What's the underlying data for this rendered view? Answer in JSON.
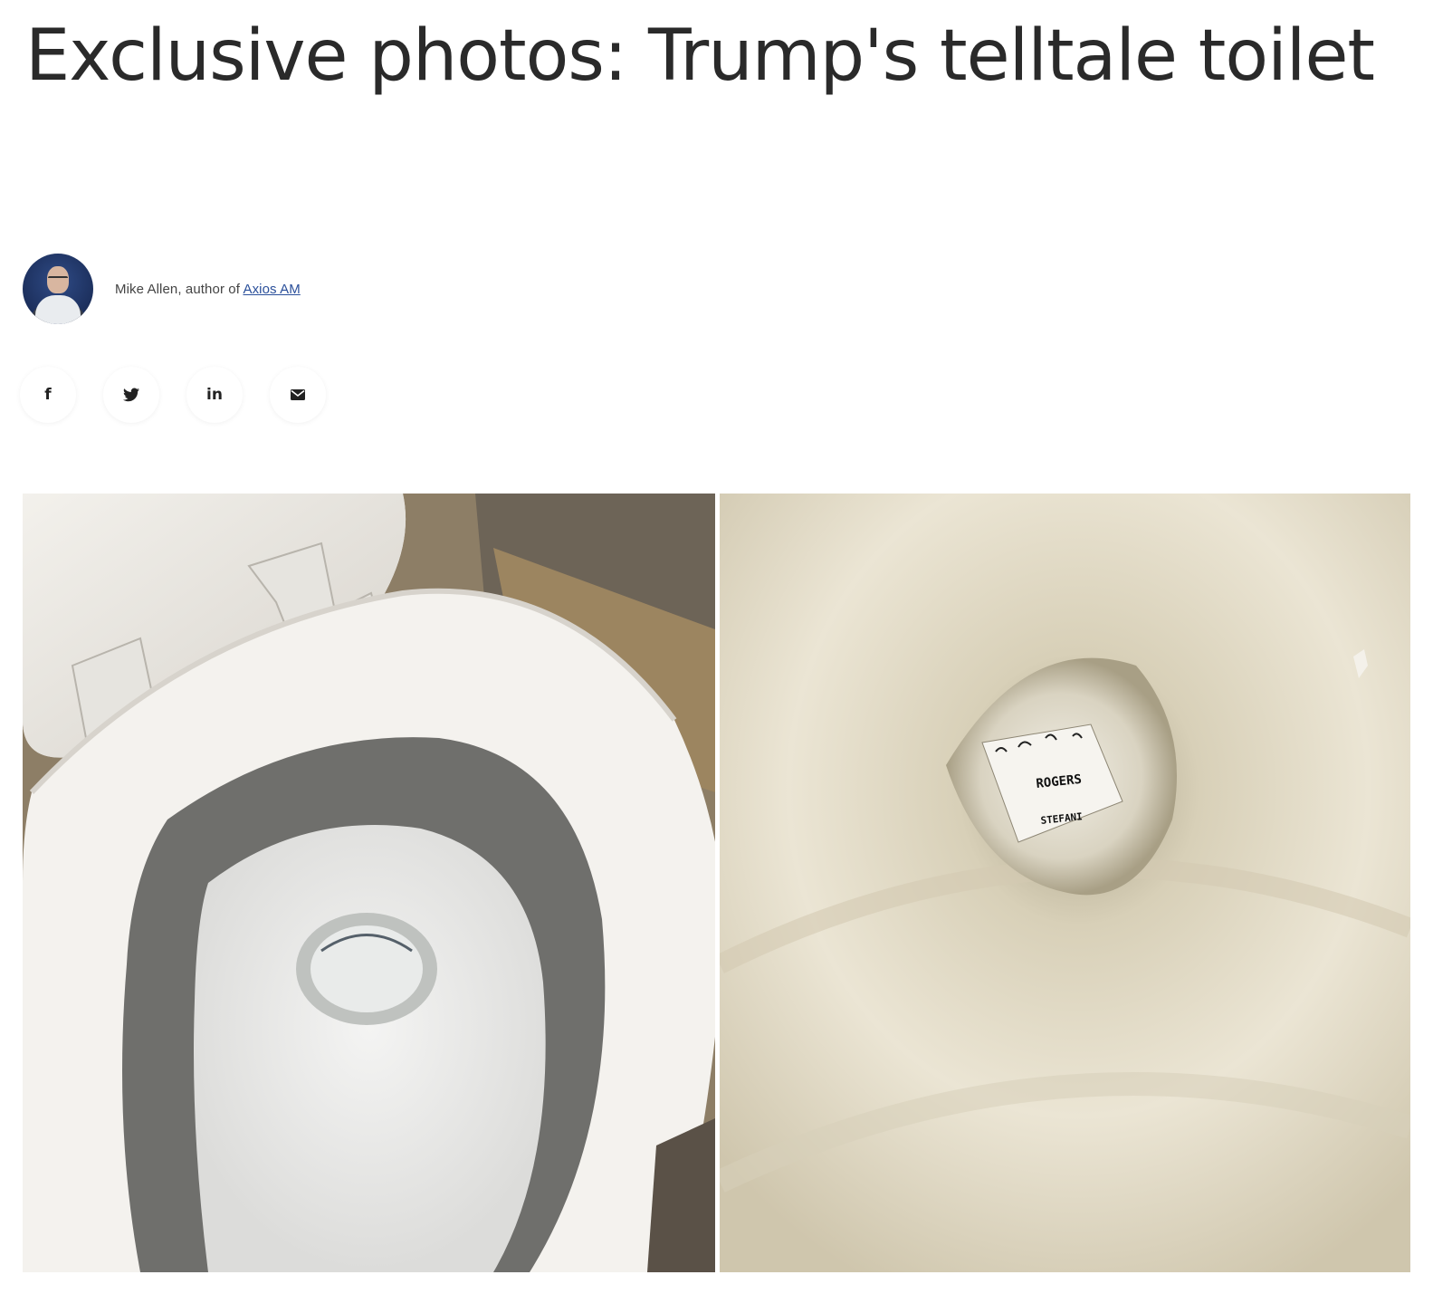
{
  "article": {
    "headline": "Exclusive photos: Trump's telltale toilet"
  },
  "byline": {
    "author": "Mike Allen",
    "prefix": ", author of ",
    "newsletter_link": "Axios AM"
  },
  "share": [
    {
      "name": "facebook-share-button",
      "glyph": "f"
    },
    {
      "name": "twitter-share-button",
      "glyph": "🐦"
    },
    {
      "name": "linkedin-share-button",
      "glyph": "in"
    },
    {
      "name": "email-share-button",
      "glyph": "✉"
    }
  ],
  "photos": {
    "right_note_line1": "ROGERS",
    "right_note_line2": "STEFANI"
  }
}
